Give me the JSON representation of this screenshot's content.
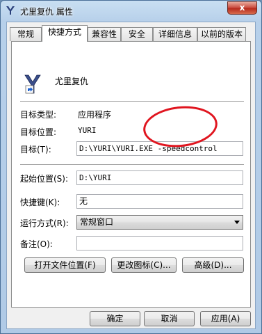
{
  "window": {
    "title": "尤里复仇 属性",
    "close_label": "x"
  },
  "tabs": [
    {
      "label": "常规",
      "active": false
    },
    {
      "label": "快捷方式",
      "active": true
    },
    {
      "label": "兼容性",
      "active": false
    },
    {
      "label": "安全",
      "active": false
    },
    {
      "label": "详细信息",
      "active": false
    },
    {
      "label": "以前的版本",
      "active": false
    }
  ],
  "shortcut": {
    "name": "尤里复仇",
    "icon": "yuri-game-shortcut-icon",
    "target_type_label": "目标类型:",
    "target_type_value": "应用程序",
    "target_location_label": "目标位置:",
    "target_location_value": "YURI",
    "target_label": "目标(T):",
    "target_value": "D:\\YURI\\YURI.EXE -speedcontrol",
    "start_in_label": "起始位置(S):",
    "start_in_value": "D:\\YURI",
    "hotkey_label": "快捷键(K):",
    "hotkey_value": "无",
    "run_label": "运行方式(R):",
    "run_value": "常规窗口",
    "comment_label": "备注(O):",
    "comment_value": "",
    "open_location_button": "打开文件位置(F)",
    "change_icon_button": "更改图标(C)...",
    "advanced_button": "高级(D)..."
  },
  "footer": {
    "ok": "确定",
    "cancel": "取消",
    "apply": "应用(A)"
  },
  "highlight": {
    "color": "#e0151f"
  }
}
